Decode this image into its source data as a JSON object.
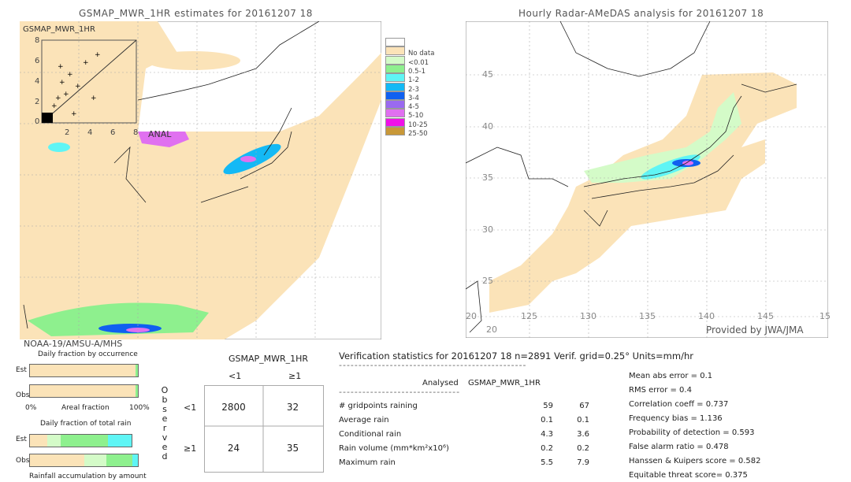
{
  "left_map": {
    "title": "GSMAP_MWR_1HR estimates for 20161207 18",
    "inset_label": "GSMAP_MWR_1HR",
    "inset_y_ticks": [
      "0",
      "2",
      "4",
      "6",
      "8"
    ],
    "inset_x_ticks": [
      "2",
      "4",
      "6",
      "8"
    ],
    "anal_label": "ANAL",
    "satellite": "NOAA-19/AMSU-A/MHS"
  },
  "right_map": {
    "title": "Hourly Radar-AMeDAS analysis for 20161207 18",
    "lat_labels": [
      "45",
      "40",
      "35",
      "30",
      "25",
      "20"
    ],
    "lon_labels": [
      "125",
      "130",
      "135",
      "140",
      "145",
      "15"
    ],
    "lon_first": "20",
    "credit": "Provided by JWA/JMA"
  },
  "legend": {
    "items": [
      {
        "label": "",
        "color": "#ffffff"
      },
      {
        "label": "No data",
        "color": "#fbe3b8"
      },
      {
        "label": "<0.01",
        "color": "#d4fbc8"
      },
      {
        "label": "0.5-1",
        "color": "#8ef08e"
      },
      {
        "label": "1-2",
        "color": "#5ff5f5"
      },
      {
        "label": "2-3",
        "color": "#14b9f5"
      },
      {
        "label": "3-4",
        "color": "#1060f0"
      },
      {
        "label": "4-5",
        "color": "#9a6af0"
      },
      {
        "label": "5-10",
        "color": "#e070f0"
      },
      {
        "label": "10-25",
        "color": "#f010e8"
      },
      {
        "label": "25-50",
        "color": "#c89838"
      }
    ]
  },
  "occurrence": {
    "title": "Daily fraction by occurrence",
    "est_label": "Est",
    "obs_label": "Obs",
    "axis_left": "0%",
    "axis_mid": "Areal fraction",
    "axis_right": "100%",
    "est_fraction_no_rain": 0.98,
    "obs_fraction_no_rain": 0.98
  },
  "total_rain": {
    "title": "Daily fraction of total rain",
    "est_label": "Est",
    "obs_label": "Obs",
    "footer": "Rainfall accumulation by amount",
    "est": [
      {
        "color": "#fbe3b8",
        "frac": 0.17
      },
      {
        "color": "#d4fbc8",
        "frac": 0.13
      },
      {
        "color": "#8ef08e",
        "frac": 0.47
      },
      {
        "color": "#5ff5f5",
        "frac": 0.23
      }
    ],
    "obs": [
      {
        "color": "#fbe3b8",
        "frac": 0.5
      },
      {
        "color": "#d4fbc8",
        "frac": 0.21
      },
      {
        "color": "#8ef08e",
        "frac": 0.24
      },
      {
        "color": "#5ff5f5",
        "frac": 0.05
      }
    ]
  },
  "contingency": {
    "title": "GSMAP_MWR_1HR",
    "col_headers": [
      "<1",
      "≥1"
    ],
    "row_headers": [
      "<1",
      "≥1"
    ],
    "observed_letters": [
      "O",
      "b",
      "s",
      "e",
      "r",
      "v",
      "e",
      "d"
    ],
    "cells": [
      [
        "2800",
        "32"
      ],
      [
        "24",
        "35"
      ]
    ]
  },
  "stats": {
    "header": "Verification statistics for 20161207 18   n=2891   Verif. grid=0.25°   Units=mm/hr",
    "dashes": "------------------------------------------------",
    "col_analysed": "Analysed",
    "col_est": "GSMAP_MWR_1HR",
    "dashes2": "-------------------------------",
    "rows": [
      {
        "label": "# gridpoints raining",
        "a": "59",
        "b": "67"
      },
      {
        "label": "Average rain",
        "a": "0.1",
        "b": "0.1"
      },
      {
        "label": "Conditional rain",
        "a": "4.3",
        "b": "3.6"
      },
      {
        "label": "Rain volume (mm*km²x10⁶)",
        "a": "0.2",
        "b": "0.2"
      },
      {
        "label": "Maximum rain",
        "a": "5.5",
        "b": "7.9"
      }
    ],
    "scores": [
      "Mean abs error = 0.1",
      "RMS error = 0.4",
      "Correlation coeff = 0.737",
      "Frequency bias = 1.136",
      "Probability of detection = 0.593",
      "False alarm ratio = 0.478",
      "Hanssen & Kuipers score = 0.582",
      "Equitable threat score= 0.375"
    ]
  }
}
